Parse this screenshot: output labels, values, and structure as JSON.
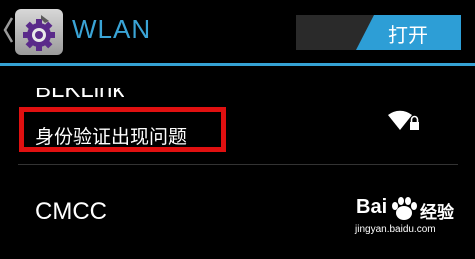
{
  "header": {
    "title": "WLAN",
    "toggle_label": "打开",
    "accent_color": "#35a2d4"
  },
  "networks": [
    {
      "ssid": "BLKLink",
      "status": "身份验证出现问题",
      "icon": "wifi-locked-icon",
      "highlight_color": "#e01010"
    },
    {
      "ssid": "CMCC"
    }
  ],
  "watermark": {
    "brand": "Bai",
    "brand_suffix": "经验",
    "url": "jingyan.baidu.com"
  }
}
